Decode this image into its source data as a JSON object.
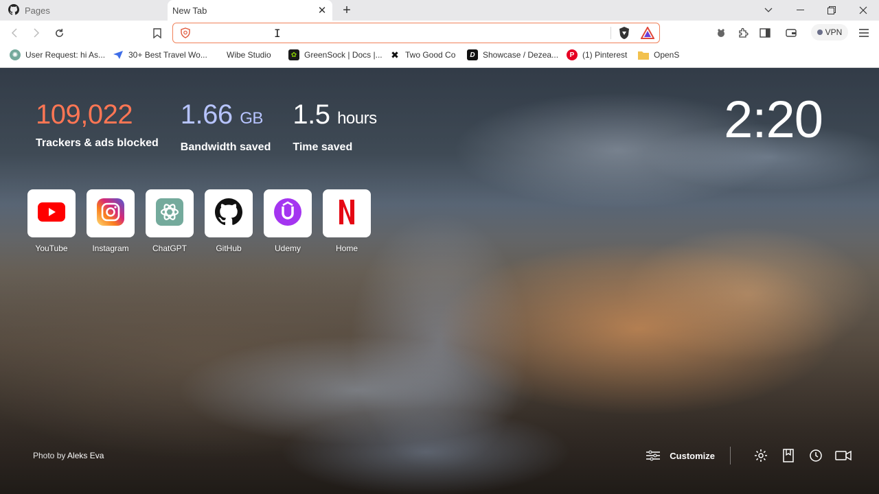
{
  "tabs": [
    {
      "title": "Pages",
      "active": false,
      "icon": "github-icon"
    },
    {
      "title": "New Tab",
      "active": true
    }
  ],
  "toolbar": {
    "address_value": "",
    "vpn_label": "VPN"
  },
  "bookmarks": [
    {
      "label": "User Request: hi As...",
      "icon": "chatgpt-icon"
    },
    {
      "label": "30+ Best Travel Wo...",
      "icon": "paper-plane-icon"
    },
    {
      "label": "Wibe Studio",
      "icon": "blank-page-icon"
    },
    {
      "label": "GreenSock | Docs |...",
      "icon": "greensock-icon"
    },
    {
      "label": "Two Good Co",
      "icon": "two-good-icon"
    },
    {
      "label": "Showcase / Dezea...",
      "icon": "dezeen-icon"
    },
    {
      "label": "(1) Pinterest",
      "icon": "pinterest-icon"
    },
    {
      "label": "OpenS",
      "icon": "folder-icon"
    }
  ],
  "stats": {
    "trackers": {
      "value": "109,022",
      "label": "Trackers & ads blocked",
      "color": "#ff7654"
    },
    "bandwidth": {
      "value": "1.66",
      "unit": "GB",
      "label": "Bandwidth saved",
      "color": "#b7c4ff"
    },
    "time": {
      "value": "1.5",
      "unit": "hours",
      "label": "Time saved"
    }
  },
  "clock": "2:20",
  "top_sites": [
    {
      "label": "YouTube",
      "icon": "youtube-icon"
    },
    {
      "label": "Instagram",
      "icon": "instagram-icon"
    },
    {
      "label": "ChatGPT",
      "icon": "chatgpt-icon"
    },
    {
      "label": "GitHub",
      "icon": "github-icon"
    },
    {
      "label": "Udemy",
      "icon": "udemy-icon"
    },
    {
      "label": "Home",
      "icon": "netflix-icon"
    }
  ],
  "photo_credit": {
    "prefix": "Photo by",
    "author": "Aleks Eva"
  },
  "customize_label": "Customize"
}
